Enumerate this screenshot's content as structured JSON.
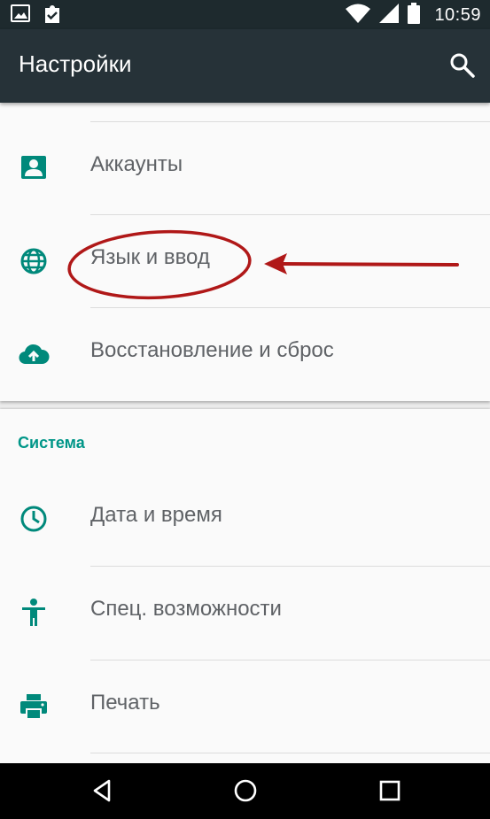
{
  "status_bar": {
    "time": "10:59",
    "icons": [
      "image-icon",
      "clipboard-check-icon",
      "wifi-icon",
      "signal-icon",
      "battery-icon"
    ]
  },
  "toolbar": {
    "title": "Настройки",
    "search_icon": "search-icon"
  },
  "personal_items": [
    {
      "label": "Аккаунты",
      "icon": "account-box-icon"
    },
    {
      "label": "Язык и ввод",
      "icon": "globe-icon"
    },
    {
      "label": "Восстановление и сброс",
      "icon": "cloud-upload-icon"
    }
  ],
  "system_section": {
    "header": "Система",
    "items": [
      {
        "label": "Дата и время",
        "icon": "clock-icon"
      },
      {
        "label": "Спец. возможности",
        "icon": "accessibility-icon"
      },
      {
        "label": "Печать",
        "icon": "printer-icon"
      }
    ]
  },
  "nav_bar": {
    "icons": [
      "back-icon",
      "home-icon",
      "recents-icon"
    ]
  },
  "colors": {
    "status_bar": "#1e2a2e",
    "toolbar": "#263238",
    "accent": "#009688",
    "annotation": "#b01818"
  }
}
